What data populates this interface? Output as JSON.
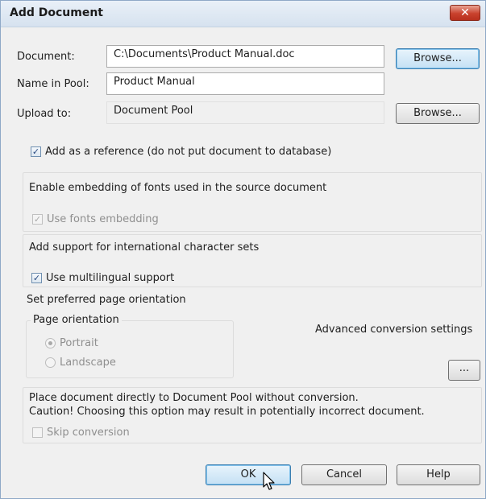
{
  "window": {
    "title": "Add Document",
    "close_glyph": "✕"
  },
  "document": {
    "label": "Document:",
    "value": "C:\\Documents\\Product Manual.doc",
    "browse_label": "Browse..."
  },
  "name_in_pool": {
    "label": "Name in Pool:",
    "value": "Product Manual"
  },
  "upload_to": {
    "label": "Upload to:",
    "value": "Document Pool",
    "browse_label": "Browse..."
  },
  "add_reference": {
    "label": "Add as a reference (do not put document to database)",
    "checked": true
  },
  "fonts": {
    "heading": "Enable embedding of fonts used in the source document",
    "checkbox_label": "Use fonts embedding",
    "checked": true,
    "disabled": true
  },
  "international": {
    "heading": "Add support for international character sets",
    "checkbox_label": "Use multilingual support",
    "checked": true
  },
  "orientation": {
    "heading": "Set preferred page orientation",
    "group_label": "Page orientation",
    "options": [
      "Portrait",
      "Landscape"
    ],
    "selected": "Portrait"
  },
  "advanced": {
    "label": "Advanced conversion settings",
    "button_label": "..."
  },
  "skip": {
    "line1": "Place document directly to Document Pool without conversion.",
    "line2": "Caution! Choosing this option may result in potentially incorrect document.",
    "checkbox_label": "Skip conversion",
    "checked": false
  },
  "buttons": {
    "ok": "OK",
    "cancel": "Cancel",
    "help": "Help"
  },
  "check_glyph": "✓"
}
